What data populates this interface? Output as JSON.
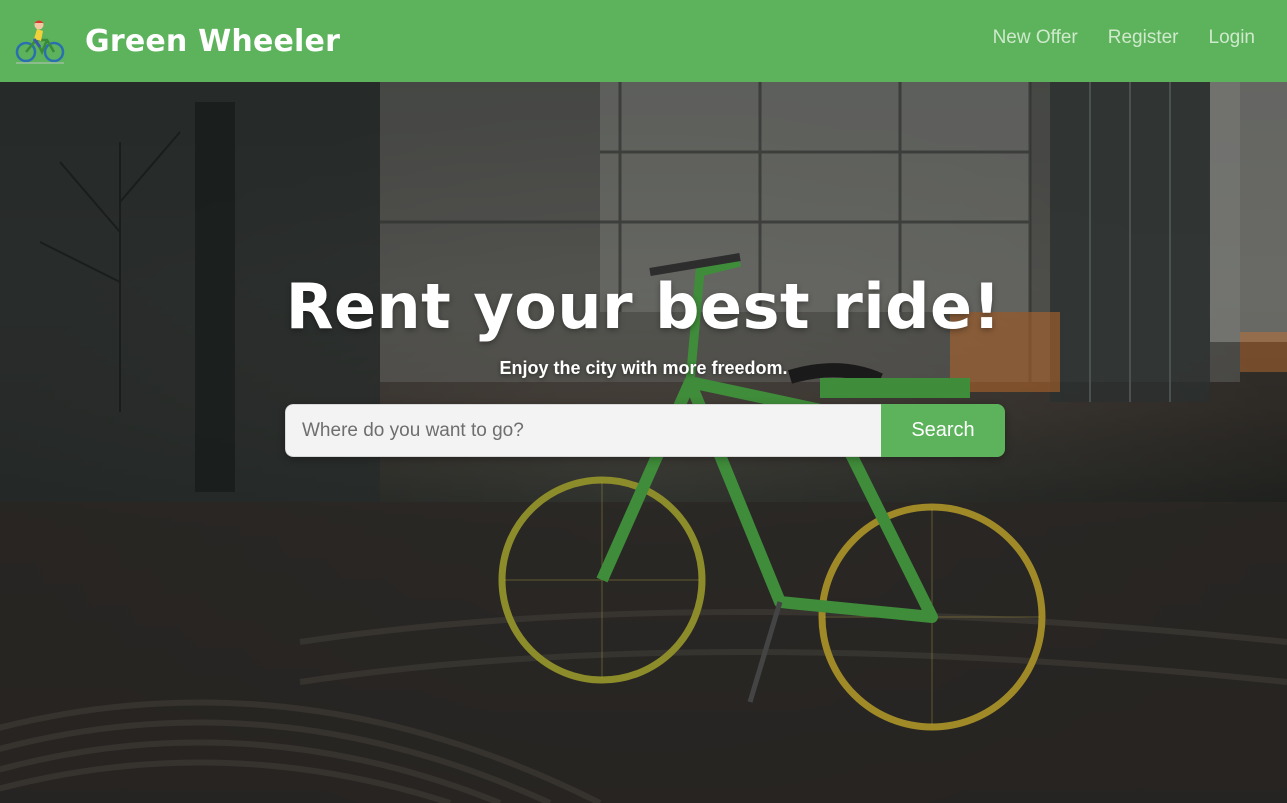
{
  "navbar": {
    "brand_name": "Green Wheeler",
    "brand_icon": "cyclist-icon",
    "links": [
      {
        "label": "New Offer"
      },
      {
        "label": "Register"
      },
      {
        "label": "Login"
      }
    ]
  },
  "hero": {
    "title": "Rent your best ride!",
    "subtitle": "Enjoy the city with more freedom.",
    "background_image": "green-bicycle-on-cobblestone-photo"
  },
  "search": {
    "placeholder": "Where do you want to go?",
    "value": "",
    "button_label": "Search"
  },
  "colors": {
    "brand_green": "#5cb35b",
    "nav_link": "#cfe9cc",
    "text_white": "#ffffff"
  }
}
